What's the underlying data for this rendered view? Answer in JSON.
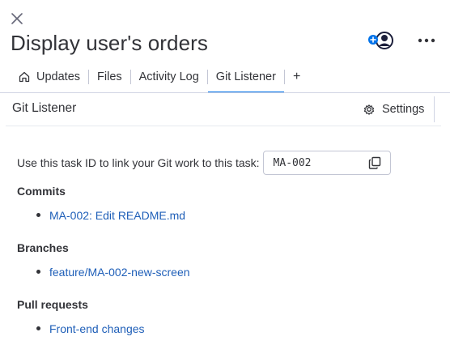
{
  "header": {
    "title": "Display user's orders",
    "close_icon": "close-icon",
    "subscriber_icon": "add-subscriber-icon",
    "more_icon": "more-horizontal-icon"
  },
  "tabs": [
    {
      "label": "Updates",
      "icon": "home-icon"
    },
    {
      "label": "Files"
    },
    {
      "label": "Activity Log"
    },
    {
      "label": "Git Listener",
      "active": true
    },
    {
      "label": "+"
    }
  ],
  "panel": {
    "title": "Git Listener",
    "settings_label": "Settings"
  },
  "task_id": {
    "label": "Use this task ID to link your Git work to this task:",
    "value": "MA-002"
  },
  "commits": {
    "title": "Commits",
    "items": [
      "MA-002: Edit README.md"
    ]
  },
  "branches": {
    "title": "Branches",
    "items": [
      "feature/MA-002-new-screen"
    ]
  },
  "pull_requests": {
    "title": "Pull requests",
    "items": [
      "Front-end changes"
    ]
  },
  "colors": {
    "accent": "#0073ea",
    "link": "#1f5fb8",
    "text": "#323338"
  }
}
